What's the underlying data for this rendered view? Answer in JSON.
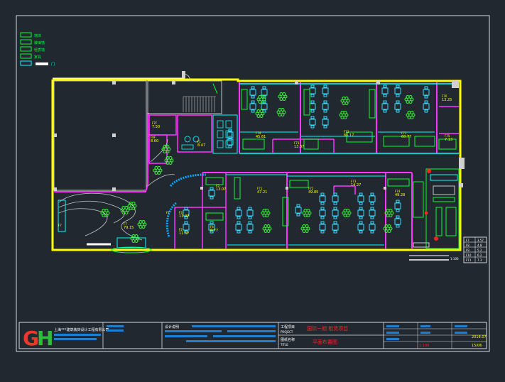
{
  "colors": {
    "background": "#212830",
    "frame": "#d8dde3",
    "exterior_wall": "#ffff00",
    "partition": "#ff33ff",
    "glass_wall": "#00ffff",
    "furniture": "#00ff33",
    "seating": "#33ddff",
    "plants": "#33ff33",
    "room_label": "#ffff00",
    "title_red": "#ff2222",
    "logo_red": "#e83a2a",
    "logo_green": "#2dbd3a"
  },
  "legend": {
    "items": [
      {
        "label": "墙体"
      },
      {
        "label": "玻璃墙"
      },
      {
        "label": "轻质墙"
      },
      {
        "label": "家具"
      },
      {
        "label": "门"
      }
    ]
  },
  "rooms": [
    {
      "id": "R7",
      "label": "7.50",
      "sub": "F7F"
    },
    {
      "id": "R8",
      "label": "8.60",
      "sub": "F8F"
    },
    {
      "id": "R9",
      "label": "8.47",
      "sub": "F1"
    },
    {
      "id": "R10",
      "label": "45.61",
      "sub": "F74"
    },
    {
      "id": "R11",
      "label": "13.37",
      "sub": "F73"
    },
    {
      "id": "R12",
      "label": "66.17",
      "sub": "F72"
    },
    {
      "id": "R13",
      "label": "60.77",
      "sub": "F71"
    },
    {
      "id": "R14",
      "label": "7.13",
      "sub": "F75"
    },
    {
      "id": "R15",
      "label": "13.25",
      "sub": "F76"
    },
    {
      "id": "R16",
      "label": "11.37",
      "sub": "F3"
    },
    {
      "id": "R17",
      "label": "13.07",
      "sub": "F5"
    },
    {
      "id": "R18",
      "label": "47.21",
      "sub": "F71"
    },
    {
      "id": "R19",
      "label": "49.85",
      "sub": "F72"
    },
    {
      "id": "R20",
      "label": "14.27",
      "sub": "F73"
    },
    {
      "id": "R21",
      "label": "49.28",
      "sub": "F74"
    },
    {
      "id": "R22",
      "label": "11.57",
      "sub": "F2"
    },
    {
      "id": "R23",
      "label": "8.77",
      "sub": "F4"
    },
    {
      "id": "R24",
      "label": "79.15",
      "sub": "F7"
    },
    {
      "id": "R25",
      "label": "",
      "sub": "F7"
    },
    {
      "id": "R26",
      "label": "",
      "sub": "F7"
    }
  ],
  "schedule": {
    "rows": [
      {
        "a": "F7",
        "b": "3.57"
      },
      {
        "a": "F8",
        "b": "4.8"
      },
      {
        "a": "F9",
        "b": "5.2"
      },
      {
        "a": "F10",
        "b": "6.2"
      },
      {
        "a": "F11",
        "b": "7.3"
      }
    ]
  },
  "scale_label": "1:100",
  "title_block": {
    "company": "上海***建筑装饰设计工程有限公司",
    "logo_text": "GH",
    "project_label": "工程项目",
    "project_label_en": "PROJECT",
    "project_value": "国际一期 租赁项目",
    "drawing_label": "图纸名称",
    "drawing_label_en": "TITLE",
    "drawing_value": "平面布置图",
    "design_label": "设计说明",
    "scale_value": "1:100",
    "date_value": "2018.07",
    "sheet_value": "15/06"
  }
}
